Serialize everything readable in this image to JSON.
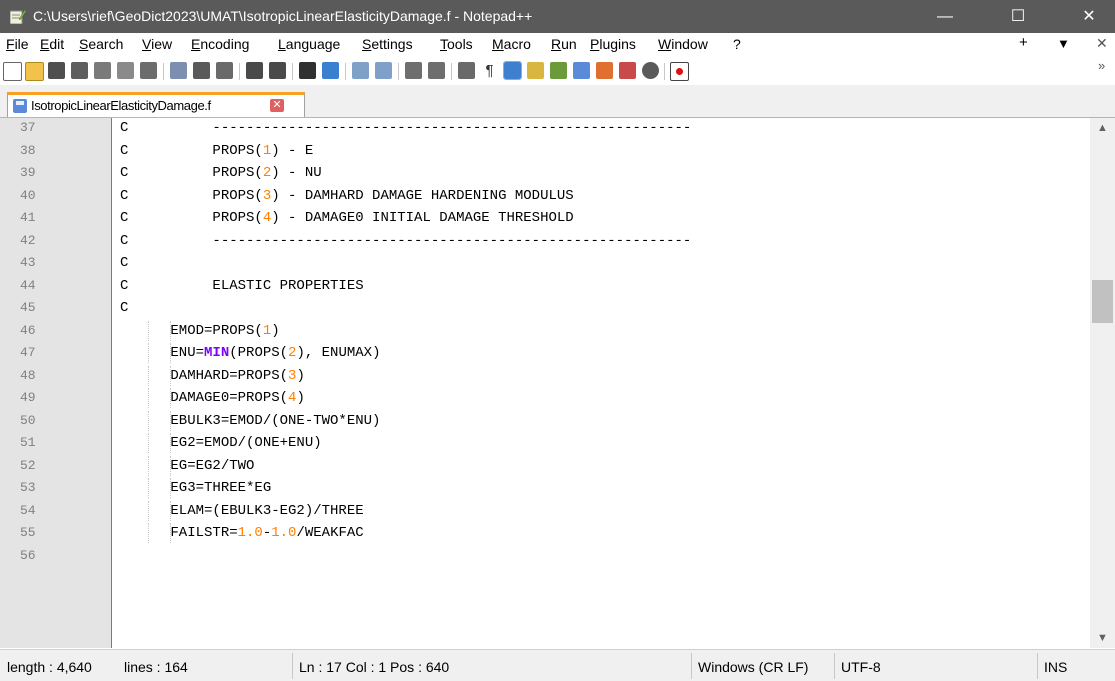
{
  "window": {
    "title": "C:\\Users\\rief\\GeoDict2023\\UMAT\\IsotropicLinearElasticityDamage.f - Notepad++",
    "minimize": "—",
    "maximize": "☐",
    "close": "✕"
  },
  "menu": {
    "items": [
      "File",
      "Edit",
      "Search",
      "View",
      "Encoding",
      "Language",
      "Settings",
      "Tools",
      "Macro",
      "Run",
      "Plugins",
      "Window",
      "?"
    ],
    "right": [
      "+",
      "▼",
      "✕"
    ]
  },
  "tab": {
    "label": "IsotropicLinearElasticityDamage.f",
    "close": "✕"
  },
  "editor": {
    "lines": [
      {
        "n": "37",
        "code": "C          ---------------------------------------------------------"
      },
      {
        "n": "38",
        "code": "C          PROPS(1) - E"
      },
      {
        "n": "39",
        "code": "C          PROPS(2) - NU"
      },
      {
        "n": "40",
        "code": "C          PROPS(3) - DAMHARD DAMAGE HARDENING MODULUS"
      },
      {
        "n": "41",
        "code": "C          PROPS(4) - DAMAGE0 INITIAL DAMAGE THRESHOLD"
      },
      {
        "n": "42",
        "code": "C          ---------------------------------------------------------"
      },
      {
        "n": "43",
        "code": "C"
      },
      {
        "n": "44",
        "code": "C          ELASTIC PROPERTIES"
      },
      {
        "n": "45",
        "code": "C"
      },
      {
        "n": "46",
        "code": "      EMOD=PROPS(1)"
      },
      {
        "n": "47",
        "code": "      ENU=MIN(PROPS(2), ENUMAX)"
      },
      {
        "n": "48",
        "code": "      DAMHARD=PROPS(3)"
      },
      {
        "n": "49",
        "code": "      DAMAGE0=PROPS(4)"
      },
      {
        "n": "50",
        "code": "      EBULK3=EMOD/(ONE-TWO*ENU)"
      },
      {
        "n": "51",
        "code": "      EG2=EMOD/(ONE+ENU)"
      },
      {
        "n": "52",
        "code": "      EG=EG2/TWO"
      },
      {
        "n": "53",
        "code": "      EG3=THREE*EG"
      },
      {
        "n": "54",
        "code": "      ELAM=(EBULK3-EG2)/THREE"
      },
      {
        "n": "55",
        "code": "      FAILSTR=1.0-1.0/WEAKFAC"
      },
      {
        "n": "56",
        "code": ""
      }
    ]
  },
  "scrollbar": {
    "up": "▲",
    "down": "▼"
  },
  "status": {
    "length": "length : 4,640",
    "lines": "lines : 164",
    "position": "Ln : 17   Col : 1   Pos : 640",
    "eol": "Windows (CR LF)",
    "encoding": "UTF-8",
    "mode": "INS"
  },
  "colors": {
    "titlebar": "#5a5a5a",
    "number": "#ff8000",
    "keyword": "#8000ff",
    "tab_accent": "#f7a024",
    "gutter_line": "#e05050"
  },
  "toolbar_icons": [
    "new-file-icon",
    "open-file-icon",
    "save-icon",
    "save-all-icon",
    "close-icon",
    "close-all-icon",
    "print-icon",
    "cut-icon",
    "copy-icon",
    "paste-icon",
    "undo-icon",
    "redo-icon",
    "find-icon",
    "replace-icon",
    "zoom-in-icon",
    "zoom-out-icon",
    "sync-vertical-icon",
    "sync-horizontal-icon",
    "word-wrap-icon",
    "show-all-chars-icon",
    "indent-guide-icon",
    "user-language-icon",
    "doc-map-icon",
    "function-list-icon",
    "folder-workspace-icon",
    "monitoring-icon",
    "record-macro-icon"
  ]
}
